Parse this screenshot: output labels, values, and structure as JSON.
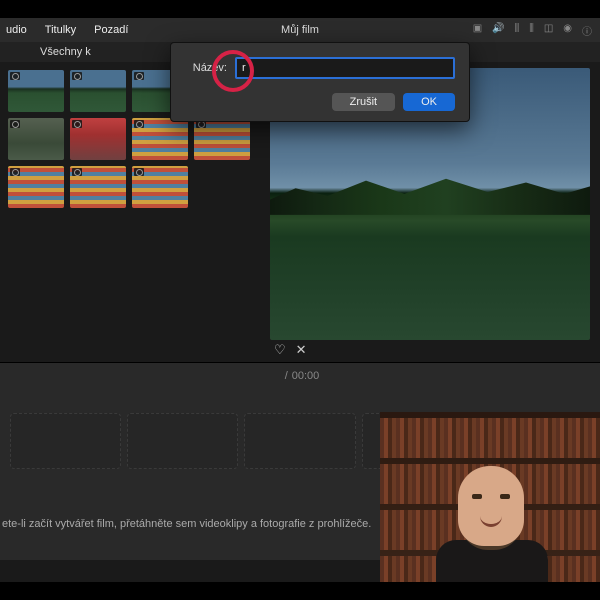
{
  "topbar": {
    "tabs": [
      "udio",
      "Titulky",
      "Pozadí"
    ],
    "title": "Můj film",
    "icons": [
      "camera",
      "volume",
      "equalizer",
      "equalizer2",
      "crop",
      "filter",
      "info"
    ]
  },
  "subbar": {
    "label": "Všechny k"
  },
  "dialog": {
    "name_label": "Název:",
    "name_value": "r",
    "cancel": "Zrušit",
    "ok": "OK"
  },
  "viewer": {
    "heart": "♡",
    "shuffle": "✕"
  },
  "timeline": {
    "time_cur": "",
    "time_sep": "/",
    "time_total": "00:00",
    "hint": "ete-li začít vytvářet film, přetáhněte sem videoklipy a fotografie z prohlížeče."
  }
}
